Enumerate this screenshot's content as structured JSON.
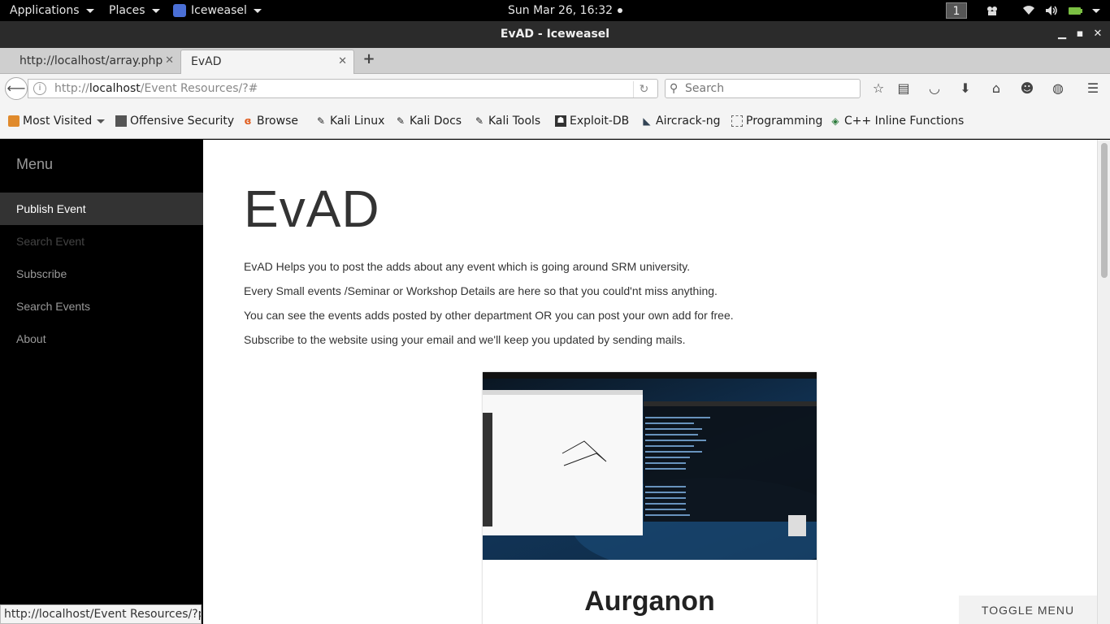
{
  "topbar": {
    "applications": "Applications",
    "places": "Places",
    "app_name": "Iceweasel",
    "clock": "Sun Mar 26, 16:32",
    "workspace": "1"
  },
  "window": {
    "title": "EvAD - Iceweasel"
  },
  "tabs": [
    {
      "label": "http://localhost/array.php"
    },
    {
      "label": "EvAD"
    }
  ],
  "nav": {
    "url_prefix": "http://",
    "url_host": "localhost",
    "url_path": "/Event Resources/?#",
    "search_placeholder": "Search"
  },
  "bookmarks": [
    {
      "label": "Most Visited",
      "icon": "folder-icon"
    },
    {
      "label": "Offensive Security",
      "icon": "offsec-icon"
    },
    {
      "label": "Browse",
      "icon": "browse-icon"
    },
    {
      "label": "Kali Linux",
      "icon": "kali-icon"
    },
    {
      "label": "Kali Docs",
      "icon": "kali-icon"
    },
    {
      "label": "Kali Tools",
      "icon": "kali-icon"
    },
    {
      "label": "Exploit-DB",
      "icon": "exploitdb-icon"
    },
    {
      "label": "Aircrack-ng",
      "icon": "aircrack-icon"
    },
    {
      "label": "Programming",
      "icon": "page-icon"
    },
    {
      "label": "C++ Inline Functions",
      "icon": "cpp-icon"
    }
  ],
  "sidebar": {
    "brand": "Menu",
    "items": [
      {
        "label": "Publish Event"
      },
      {
        "label": "Search Event"
      },
      {
        "label": "Subscribe"
      },
      {
        "label": "Search Events"
      },
      {
        "label": "About"
      }
    ]
  },
  "main": {
    "title": "EvAD",
    "paragraphs": [
      "EvAD Helps you to post the adds about any event which is going around SRM university.",
      "Every Small events /Seminar or Workshop Details are here so that you could'nt miss anything.",
      "You can see the events adds posted by other department OR you can post your own add for free.",
      "Subscribe to the website using your email and we'll keep you updated by sending mails."
    ],
    "card": {
      "title": "Aurganon"
    },
    "toggle_menu": "TOGGLE MENU"
  },
  "statusbar": {
    "text": "http://localhost/Event Resources/?pe"
  },
  "colors": {
    "sidebar_bg": "#000000",
    "sidebar_active": "#333333",
    "topbar_bg": "#000000"
  }
}
